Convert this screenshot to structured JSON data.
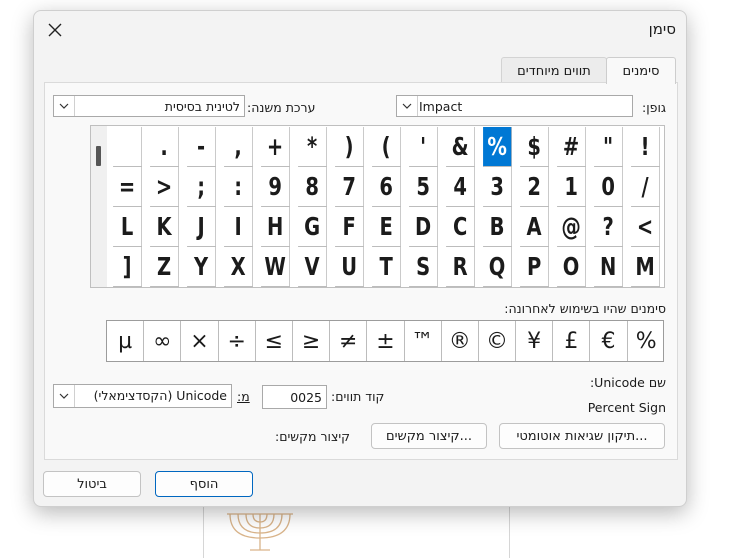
{
  "dialog": {
    "title": "סימן",
    "tabs": [
      "סימנים",
      "תווים מיוחדים"
    ]
  },
  "symbols": {
    "font_label": "גופן:",
    "font_value": "Impact",
    "subset_label": "ערכת משנה:",
    "subset_value": "לטינית בסיסית",
    "grid": [
      [
        "!",
        "\"",
        "#",
        "$",
        "%",
        "&",
        "'",
        "(",
        ")",
        "*",
        "+",
        ",",
        "-",
        ".",
        ""
      ],
      [
        "/",
        "0",
        "1",
        "2",
        "3",
        "4",
        "5",
        "6",
        "7",
        "8",
        "9",
        ":",
        ";",
        ">",
        "="
      ],
      [
        "<",
        "?",
        "@",
        "A",
        "B",
        "C",
        "D",
        "E",
        "F",
        "G",
        "H",
        "I",
        "J",
        "K",
        "L"
      ],
      [
        "M",
        "N",
        "O",
        "P",
        "Q",
        "R",
        "S",
        "T",
        "U",
        "V",
        "W",
        "X",
        "Y",
        "Z",
        "]"
      ]
    ],
    "selected": "%",
    "recent_label": "סימנים שהיו בשימוש לאחרונה:",
    "recent": [
      "%",
      "€",
      "£",
      "¥",
      "©",
      "®",
      "™",
      "±",
      "≠",
      "≥",
      "≤",
      "÷",
      "×",
      "∞",
      "µ"
    ],
    "unicode_name_label": "שם Unicode:",
    "unicode_name_value": "Percent Sign",
    "char_code_label": "קוד תווים:",
    "char_code_value": "0025",
    "from_label": "מ:",
    "from_value": "Unicode (הקסדצימאלי)",
    "autocorrect_button": "תיקון שגיאות אוטומטי...",
    "shortcut_button": "קיצור מקשים...",
    "shortcut_label": "קיצור מקשים:"
  },
  "footer": {
    "insert_button": "הוסף",
    "cancel_button": "ביטול"
  },
  "colors": {
    "accent": "#0078d4",
    "primary_border": "#0067c0"
  },
  "icons": {
    "close": "close-icon",
    "dropdown": "chevron-down-icon"
  }
}
